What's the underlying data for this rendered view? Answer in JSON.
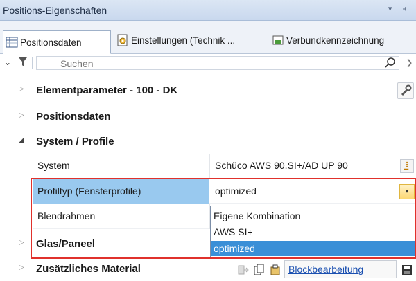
{
  "window": {
    "title": "Positions-Eigenschaften",
    "controls": "▾ ⫞"
  },
  "tabs": [
    {
      "label": "Positionsdaten",
      "icon": "table-icon"
    },
    {
      "label": "Einstellungen (Technik ...",
      "icon": "settings-doc-icon"
    },
    {
      "label": "Verbundkennzeichnung",
      "icon": "link-doc-icon"
    }
  ],
  "search": {
    "placeholder": "Suchen",
    "collapse": "❯"
  },
  "categories": {
    "elementparameter": "Elementparameter - 100 - DK",
    "positionsdaten": "Positionsdaten",
    "system_profile": "System / Profile",
    "glas_paneel": "Glas/Paneel",
    "zusaetzliches_material": "Zusätzliches Material"
  },
  "properties": {
    "system": {
      "name": "System",
      "value": "Schüco AWS 90.SI+/AD UP 90"
    },
    "profiltyp": {
      "name": "Profiltyp (Fensterprofile)",
      "value": "optimized"
    },
    "blendrahmen": {
      "name": "Blendrahmen",
      "value": ""
    }
  },
  "dropdown_options": [
    "Eigene Kombination",
    "AWS SI+",
    "optimized"
  ],
  "toolbar": {
    "bulk_edit_link": "Blockbearbeitung"
  },
  "colors": {
    "selection": "#99c9ef",
    "highlight": "#e0312c",
    "option_selected": "#3a8fd7"
  }
}
